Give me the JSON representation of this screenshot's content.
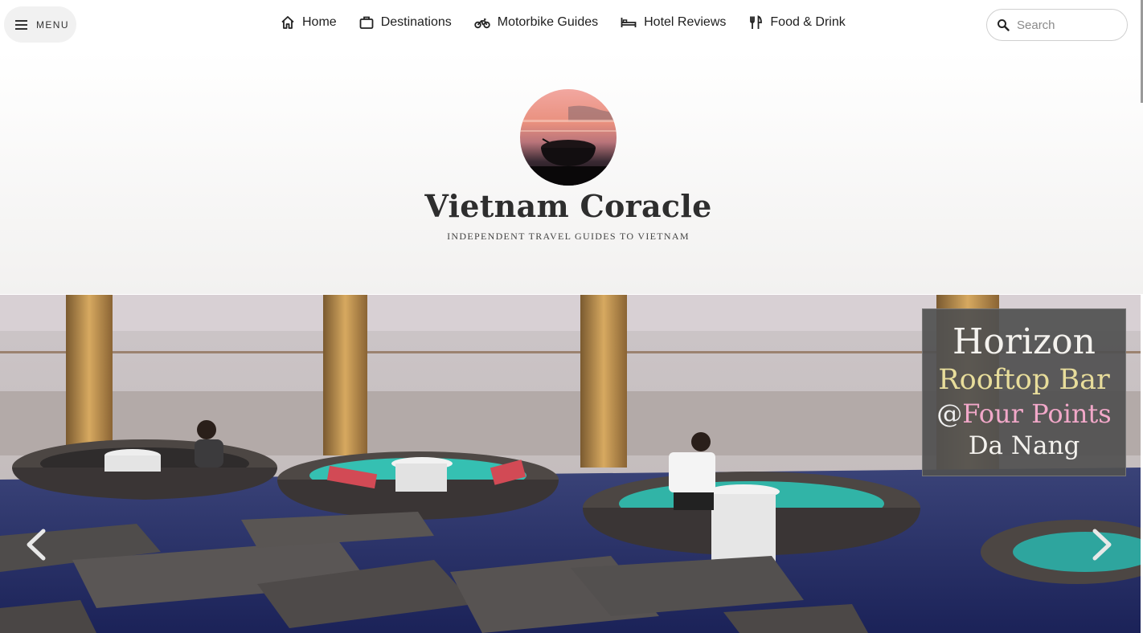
{
  "topbar": {
    "menu_label": "MENU",
    "nav": [
      {
        "label": "Home",
        "icon": "home-icon"
      },
      {
        "label": "Destinations",
        "icon": "briefcase-icon"
      },
      {
        "label": "Motorbike Guides",
        "icon": "motorbike-icon"
      },
      {
        "label": "Hotel Reviews",
        "icon": "bed-icon"
      },
      {
        "label": "Food & Drink",
        "icon": "cutlery-icon"
      }
    ],
    "search": {
      "placeholder": "Search",
      "value": ""
    }
  },
  "header": {
    "title": "Vietnam Coracle",
    "tagline": "INDEPENDENT TRAVEL GUIDES TO VIETNAM",
    "logo": "coracle-sunset-logo"
  },
  "slider": {
    "caption": {
      "line1": "Horizon",
      "line2": "Rooftop Bar",
      "line3_at": "@",
      "line3_name": "Four Points",
      "line4": "Da Nang"
    },
    "prev_icon": "chevron-left-icon",
    "next_icon": "chevron-right-icon"
  },
  "colors": {
    "caption_bg": "#505050",
    "caption_yellow": "#e8dd9b",
    "caption_pink": "#f2a8c9",
    "pool_water": "#26306e",
    "seat_teal": "#2fa5a0"
  }
}
